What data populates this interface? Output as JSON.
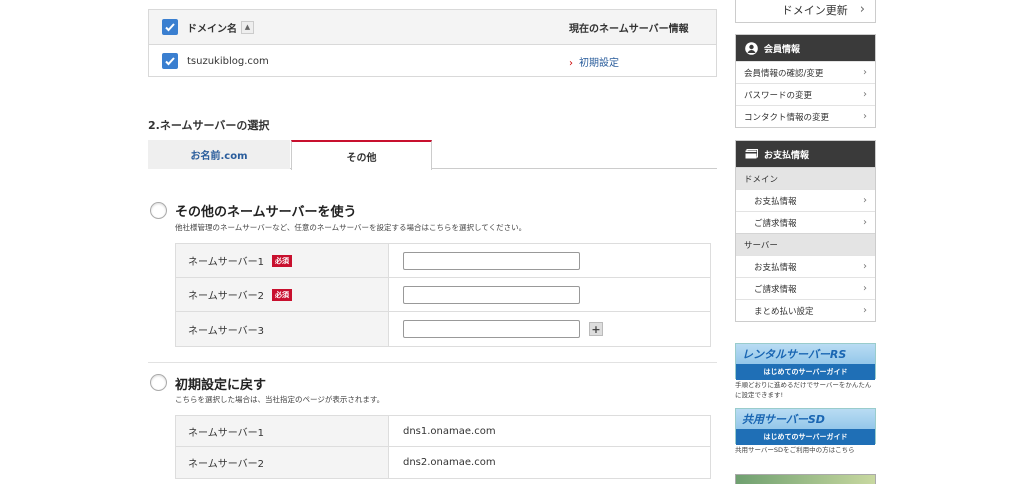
{
  "domain_table": {
    "header_label": "ドメイン名",
    "sort_icon": "▲",
    "header_right": "現在のネームサーバー情報",
    "rows": [
      {
        "domain": "tsuzukiblog.com",
        "ns_link": "初期設定"
      }
    ]
  },
  "section_title": "2.ネームサーバーの選択",
  "tabs": [
    {
      "label": "お名前.com"
    },
    {
      "label": "その他"
    }
  ],
  "option_other": {
    "title": "その他のネームサーバーを使う",
    "description": "他社様管理のネームサーバーなど、任意のネームサーバーを設定する場合はこちらを選択してください。",
    "required_badge": "必須",
    "rows": [
      {
        "label": "ネームサーバー1",
        "value": "",
        "required": true
      },
      {
        "label": "ネームサーバー2",
        "value": "",
        "required": true
      },
      {
        "label": "ネームサーバー3",
        "value": "",
        "required": false
      }
    ],
    "add_label": "+"
  },
  "option_default": {
    "title": "初期設定に戻す",
    "description": "こちらを選択した場合は、当社指定のページが表示されます。",
    "rows": [
      {
        "label": "ネームサーバー1",
        "value": "dns1.onamae.com"
      },
      {
        "label": "ネームサーバー2",
        "value": "dns2.onamae.com"
      }
    ]
  },
  "sidebar": {
    "renew_label": "ドメイン更新",
    "member": {
      "title": "会員情報",
      "icon": "user-icon",
      "items": [
        "会員情報の確認/変更",
        "パスワードの変更",
        "コンタクト情報の変更"
      ]
    },
    "payment": {
      "title": "お支払情報",
      "icon": "card-icon",
      "domain_category": "ドメイン",
      "domain_items": [
        "お支払情報",
        "ご請求情報"
      ],
      "server_category": "サーバー",
      "server_items": [
        "お支払情報",
        "ご請求情報",
        "まとめ払い設定"
      ]
    },
    "banners": [
      {
        "top": "レンタルサーバーRS",
        "bottom": "はじめてのサーバーガイド",
        "text": "手順どおりに進めるだけでサーバーをかんたんに設定できます!"
      },
      {
        "top": "共用サーバーSD",
        "bottom": "はじめてのサーバーガイド",
        "text": "共用サーバーSDをご利用中の方はこちら"
      }
    ]
  },
  "colors": {
    "accent": "#c8102e",
    "link": "#2a5d9c",
    "checkbox": "#3a7fd0",
    "panel_head": "#3a3a3a"
  }
}
